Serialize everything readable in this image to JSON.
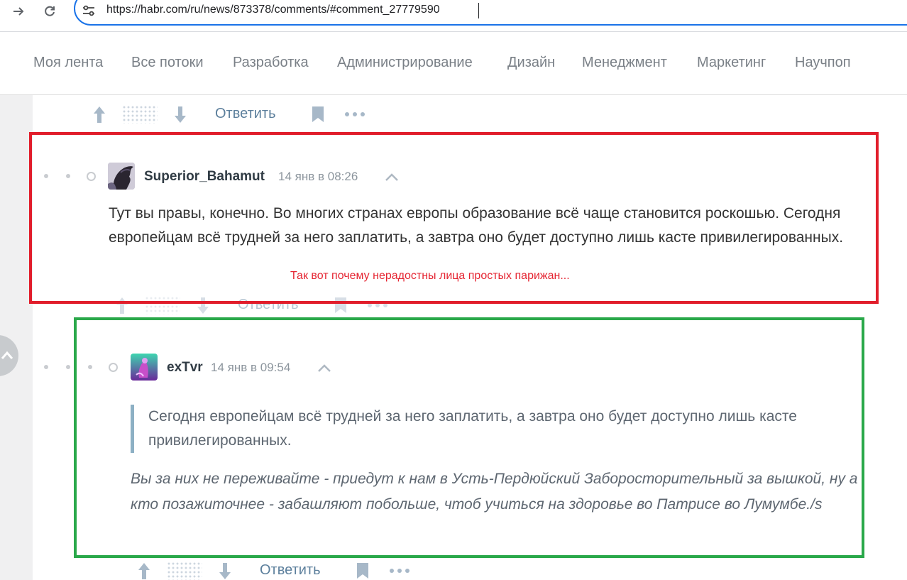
{
  "browser": {
    "url": "https://habr.com/ru/news/873378/comments/#comment_27779590",
    "icons": [
      "forward-icon",
      "reload-icon",
      "site-settings-icon"
    ]
  },
  "hubs": [
    "Моя лента",
    "Все потоки",
    "Разработка",
    "Администрирование",
    "Дизайн",
    "Менеджмент",
    "Маркетинг",
    "Научпоп"
  ],
  "actions": {
    "reply_label": "Ответить"
  },
  "comments": [
    {
      "author": "Superior_Bahamut",
      "time": "14 янв в 08:26",
      "text": "Тут вы правы, конечно. Во многих странах европы образование всё чаще становится роскошью. Сегодня европейцам всё трудней за него заплатить, а завтра оно будет доступно лишь касте привилегированных."
    },
    {
      "author": "exTvr",
      "time": "14 янв в 09:54",
      "quote": "Сегодня европейцам всё трудней за него заплатить, а завтра оно будет доступно лишь касте привилегированных.",
      "text": "Вы за них не переживайте - приедут к нам в Усть-Пердюйский Заборосторительный за вышкой, ну а кто позажиточнее - забашляют побольше, чтоб учиться на здоровье во Патрисе во Лумумбе./s"
    }
  ],
  "annotation": "Так вот почему нерадостны лица простых парижан...",
  "colors": {
    "highlight_red": "#e11d2b",
    "highlight_green": "#2aa84a",
    "annotation_text": "#e52532",
    "link": "#5c7f9c"
  }
}
